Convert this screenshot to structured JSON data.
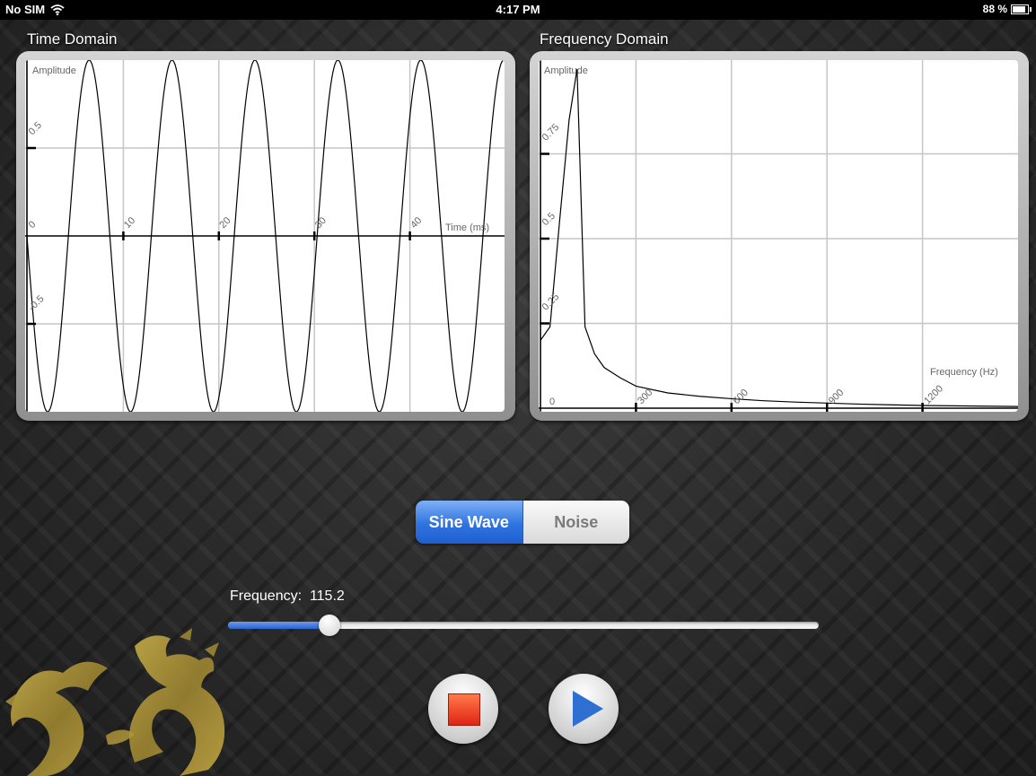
{
  "status_bar": {
    "carrier": "No SIM",
    "time": "4:17 PM",
    "battery": "88 %",
    "battery_level": 0.88
  },
  "time_domain": {
    "title": "Time Domain",
    "y_label": "Amplitude",
    "x_label": "Time (ms)",
    "x_ticks": [
      "10",
      "20",
      "30",
      "40"
    ],
    "y_ticks": [
      "0.5",
      "0",
      "-0.5"
    ]
  },
  "frequency_domain": {
    "title": "Frequency Domain",
    "y_label": "Amplitude",
    "x_label": "Frequency (Hz)",
    "x_ticks": [
      "0",
      "300",
      "600",
      "900",
      "1200"
    ],
    "y_ticks": [
      "0.75",
      "0.5",
      "0.25"
    ]
  },
  "chart_data": [
    {
      "type": "line",
      "title": "Time Domain",
      "xlabel": "Time (ms)",
      "ylabel": "Amplitude",
      "xlim": [
        0,
        50
      ],
      "ylim": [
        -1,
        1
      ],
      "grid": true,
      "series": [
        {
          "function": "sine",
          "frequency_hz": 115.2,
          "amplitude": 1,
          "phase_rad": 3.1416
        }
      ]
    },
    {
      "type": "line",
      "title": "Frequency Domain",
      "xlabel": "Frequency (Hz)",
      "ylabel": "Amplitude",
      "xlim": [
        0,
        1500
      ],
      "ylim": [
        0,
        1
      ],
      "grid": true,
      "series": [
        {
          "x": [
            0,
            30,
            60,
            90,
            115,
            140,
            170,
            200,
            250,
            300,
            400,
            500,
            600,
            700,
            800,
            900,
            1000,
            1100,
            1200,
            1300,
            1400,
            1500
          ],
          "y": [
            0.2,
            0.24,
            0.55,
            0.85,
            1.0,
            0.24,
            0.16,
            0.12,
            0.09,
            0.065,
            0.045,
            0.035,
            0.028,
            0.022,
            0.018,
            0.015,
            0.012,
            0.01,
            0.008,
            0.007,
            0.006,
            0.005
          ]
        }
      ]
    }
  ],
  "signal_type": {
    "options": [
      "Sine Wave",
      "Noise"
    ],
    "selected": "Sine Wave"
  },
  "frequency_control": {
    "label": "Frequency:",
    "value": "115.2",
    "slider_fraction": 0.095
  },
  "colors": {
    "accent_blue": "#2f73e0",
    "stop_red": "#e02414",
    "play_blue": "#2f6fd2",
    "dragon_gold": "#b59a3a"
  }
}
